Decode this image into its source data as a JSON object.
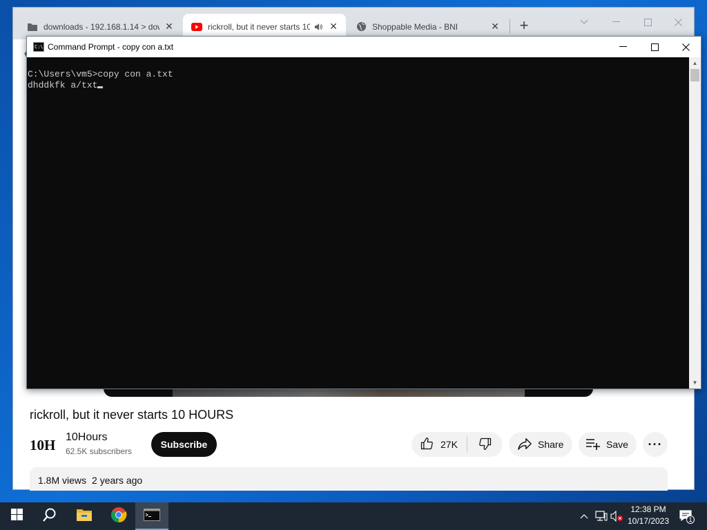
{
  "browser": {
    "tabs": [
      {
        "title": "downloads - 192.168.1.14 > dow",
        "icon": "folder-icon"
      },
      {
        "title": "rickroll, but it never starts 10",
        "icon": "youtube-icon",
        "audio": true
      },
      {
        "title": "Shoppable Media - BNI",
        "icon": "globe-icon"
      }
    ],
    "new_tab": "+"
  },
  "cmd": {
    "title": "Command Prompt - copy  con a.txt",
    "lines": [
      "C:\\Users\\vm5>copy con a.txt",
      "dhddkfk a/txt"
    ]
  },
  "video": {
    "title": "rickroll, but it never starts 10 HOURS",
    "channel_logo": "10H",
    "channel_name": "10Hours",
    "subscribers": "62.5K subscribers",
    "subscribe": "Subscribe",
    "likes": "27K",
    "share": "Share",
    "save": "Save",
    "more": "···",
    "views": "1.8M views",
    "age": "2 years ago"
  },
  "taskbar": {
    "apps": [
      "start-icon",
      "search-icon",
      "file-explorer-icon",
      "chrome-icon",
      "command-prompt-icon"
    ],
    "clock_time": "12:38 PM",
    "clock_date": "10/17/2023",
    "notification_count": "1"
  },
  "colors": {
    "youtube_red": "#ff0000",
    "terminal_bg": "#0c0c0c",
    "terminal_text": "#cccccc",
    "taskbar_bg": "#1c2733"
  }
}
